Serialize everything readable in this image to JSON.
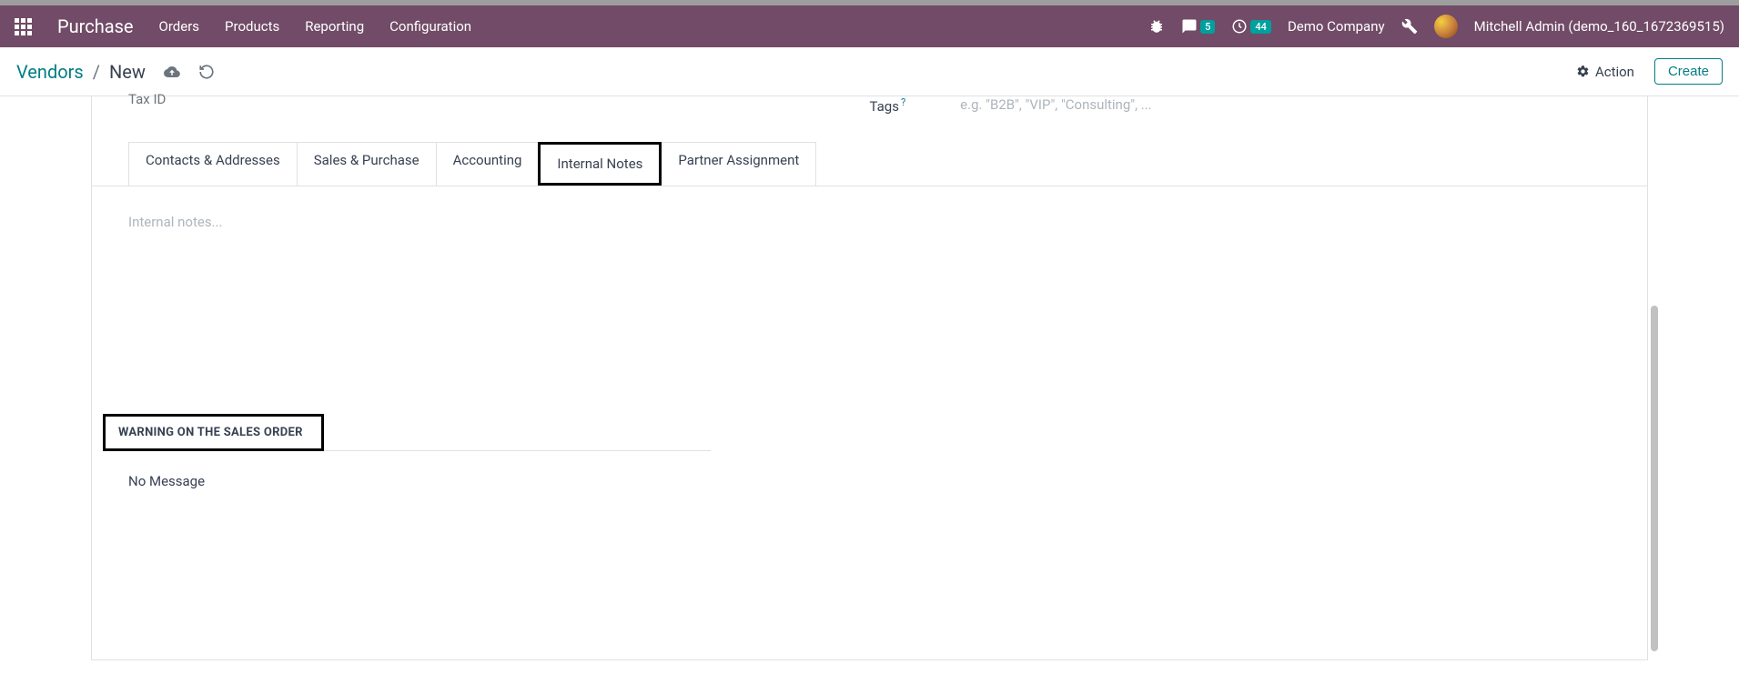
{
  "navbar": {
    "app": "Purchase",
    "menu": [
      "Orders",
      "Products",
      "Reporting",
      "Configuration"
    ],
    "messages_badge": "5",
    "activities_badge": "44",
    "company": "Demo Company",
    "user": "Mitchell Admin (demo_160_1672369515)"
  },
  "breadcrumb": {
    "root": "Vendors",
    "current": "New"
  },
  "actions": {
    "action_label": "Action",
    "create_label": "Create"
  },
  "form": {
    "tax_id_label": "Tax ID",
    "tags_label": "Tags",
    "tags_placeholder": "e.g. \"B2B\", \"VIP\", \"Consulting\", ..."
  },
  "tabs": [
    {
      "label": "Contacts & Addresses"
    },
    {
      "label": "Sales & Purchase"
    },
    {
      "label": "Accounting"
    },
    {
      "label": "Internal Notes",
      "active": true
    },
    {
      "label": "Partner Assignment"
    }
  ],
  "internal_notes": {
    "placeholder": "Internal notes..."
  },
  "warning": {
    "title": "WARNING ON THE SALES ORDER",
    "value": "No Message"
  }
}
